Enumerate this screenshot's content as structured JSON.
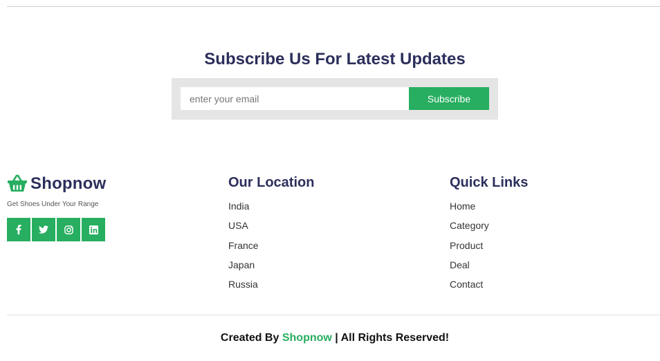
{
  "subscribe": {
    "title": "Subscribe Us For Latest Updates",
    "email_placeholder": "enter your email",
    "button_label": "Subscribe"
  },
  "brand": {
    "name": "Shopnow",
    "tagline": "Get Shoes Under Your Range",
    "logo_icon": "shopping-basket-icon",
    "social": [
      {
        "name": "facebook-icon"
      },
      {
        "name": "twitter-icon"
      },
      {
        "name": "instagram-icon"
      },
      {
        "name": "linkedin-icon"
      }
    ]
  },
  "location": {
    "title": "Our Location",
    "items": [
      "India",
      "USA",
      "France",
      "Japan",
      "Russia"
    ]
  },
  "quick_links": {
    "title": "Quick Links",
    "items": [
      "Home",
      "Category",
      "Product",
      "Deal",
      "Contact"
    ]
  },
  "credits": {
    "prefix": "Created By",
    "brand": "Shopnow",
    "suffix": "| All Rights Reserved!"
  },
  "colors": {
    "accent": "#27ae60",
    "heading": "#2c2f5b",
    "subscribe_bg": "#e5e5e5"
  }
}
